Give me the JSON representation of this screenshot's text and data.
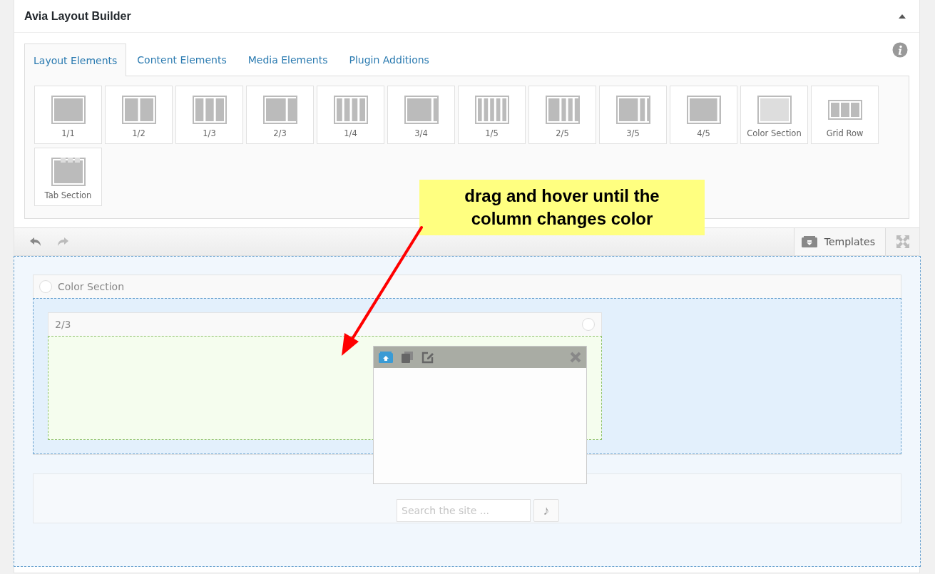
{
  "panel": {
    "title": "Avia Layout Builder",
    "collapsed": false
  },
  "tabs": [
    {
      "label": "Layout Elements",
      "selected": true
    },
    {
      "label": "Content Elements",
      "selected": false
    },
    {
      "label": "Media Elements",
      "selected": false
    },
    {
      "label": "Plugin Additions",
      "selected": false
    }
  ],
  "elements": [
    {
      "label": "1/1"
    },
    {
      "label": "1/2"
    },
    {
      "label": "1/3"
    },
    {
      "label": "2/3"
    },
    {
      "label": "1/4"
    },
    {
      "label": "3/4"
    },
    {
      "label": "1/5"
    },
    {
      "label": "2/5"
    },
    {
      "label": "3/5"
    },
    {
      "label": "4/5"
    },
    {
      "label": "Color Section"
    },
    {
      "label": "Grid Row"
    },
    {
      "label": "Tab Section"
    }
  ],
  "toolbar": {
    "templates_button": "Templates"
  },
  "canvas": {
    "color_section": {
      "title": "Color Section",
      "column": {
        "title": "2/3",
        "highlighted": true
      }
    },
    "search": {
      "placeholder": "Search the site ..."
    },
    "search_button": "♪"
  },
  "callout": {
    "text": "drag and hover until the column changes color"
  }
}
